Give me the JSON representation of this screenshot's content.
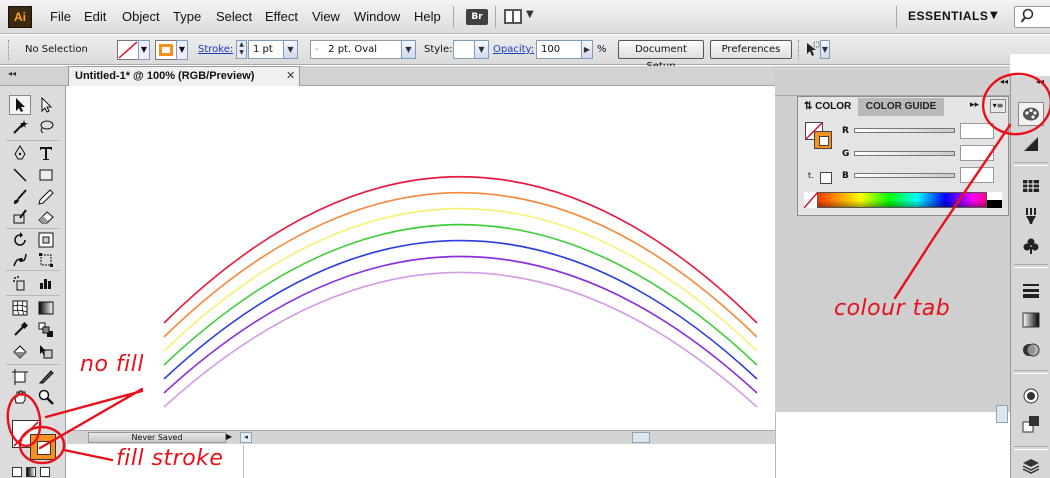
{
  "app": {
    "logo_text": "Ai",
    "bridge_label": "Br"
  },
  "menu": [
    "File",
    "Edit",
    "Object",
    "Type",
    "Select",
    "Effect",
    "View",
    "Window",
    "Help"
  ],
  "workspace": {
    "label": "ESSENTIALS"
  },
  "control_bar": {
    "selection_status": "No Selection",
    "stroke_label": "Stroke:",
    "stroke_weight": "1 pt",
    "brush": "2 pt. Oval",
    "style_label": "Style:",
    "opacity_label": "Opacity:",
    "opacity_value": "100",
    "percent": "%",
    "document_setup": "Document Setup",
    "preferences": "Preferences"
  },
  "document": {
    "tab_title": "Untitled-1* @ 100% (RGB/Preview)",
    "close_glyph": "✕"
  },
  "status_bar": {
    "text": "Never Saved"
  },
  "color_panel": {
    "tab_color": "COLOR",
    "tab_color_guide": "COLOR GUIDE",
    "channels": [
      "R",
      "G",
      "B"
    ]
  },
  "rainbow": {
    "colors": [
      "#e8193c",
      "#f7883a",
      "#f8f078",
      "#3fce3a",
      "#2b3ee0",
      "#8a2ee0",
      "#d39ce6"
    ]
  },
  "annotations": {
    "no_fill": "no fill",
    "fill_stroke": "fill stroke",
    "colour_tab": "colour tab",
    "color": "#e8101a"
  }
}
